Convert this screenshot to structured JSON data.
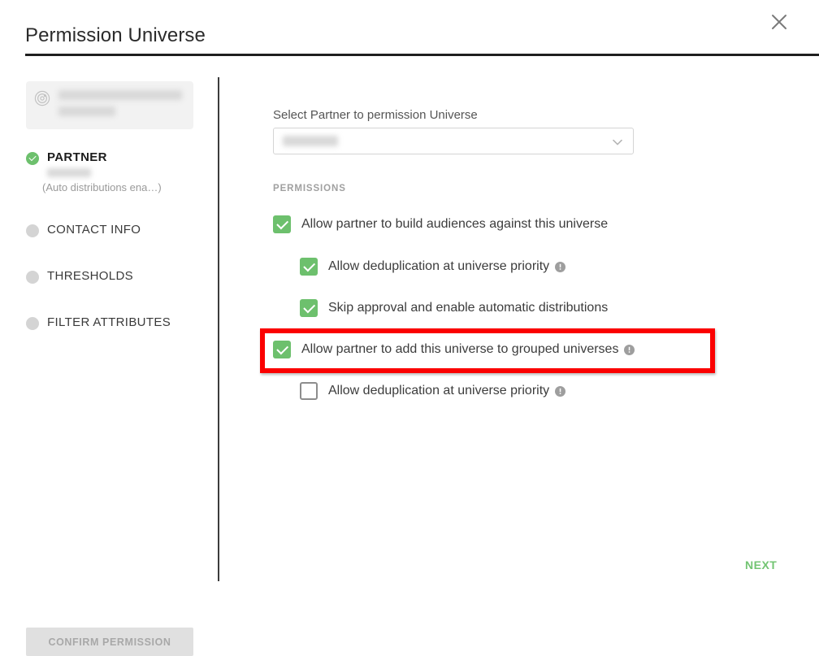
{
  "dialog": {
    "title": "Permission Universe",
    "close_icon": "close-icon"
  },
  "sidebar": {
    "universe_card": {
      "icon": "universe-icon",
      "name_redacted": true
    },
    "steps": [
      {
        "label": "PARTNER",
        "state": "complete",
        "active": true,
        "sub_note": "(Auto distributions ena…)"
      },
      {
        "label": "CONTACT INFO",
        "state": "pending",
        "active": false
      },
      {
        "label": "THRESHOLDS",
        "state": "pending",
        "active": false
      },
      {
        "label": "FILTER ATTRIBUTES",
        "state": "pending",
        "active": false
      }
    ],
    "confirm_button": {
      "label": "CONFIRM PERMISSION",
      "enabled": false
    }
  },
  "main": {
    "partner_select_label": "Select Partner to permission Universe",
    "partner_select": {
      "value": "",
      "placeholder": "",
      "chevron_icon": "chevron-down-icon"
    },
    "permissions_heading": "PERMISSIONS",
    "permissions": [
      {
        "label": "Allow partner to build audiences against this universe",
        "checked": true,
        "indent": 0,
        "info": false
      },
      {
        "label": "Allow deduplication at universe priority",
        "checked": true,
        "indent": 1,
        "info": true
      },
      {
        "label": "Skip approval and enable automatic distributions",
        "checked": true,
        "indent": 1,
        "info": false
      },
      {
        "label": "Allow partner to add this universe to grouped universes",
        "checked": true,
        "indent": 0,
        "info": true,
        "highlighted": true
      },
      {
        "label": "Allow deduplication at universe priority",
        "checked": false,
        "indent": 1,
        "info": true
      }
    ],
    "next_button": {
      "label": "NEXT"
    }
  },
  "colors": {
    "accent_green": "#6dc06d",
    "next_green": "#72c472",
    "highlight_red": "#fb0000",
    "muted_grey": "#a0a0a0",
    "divider_dark": "#1f1f1f"
  }
}
